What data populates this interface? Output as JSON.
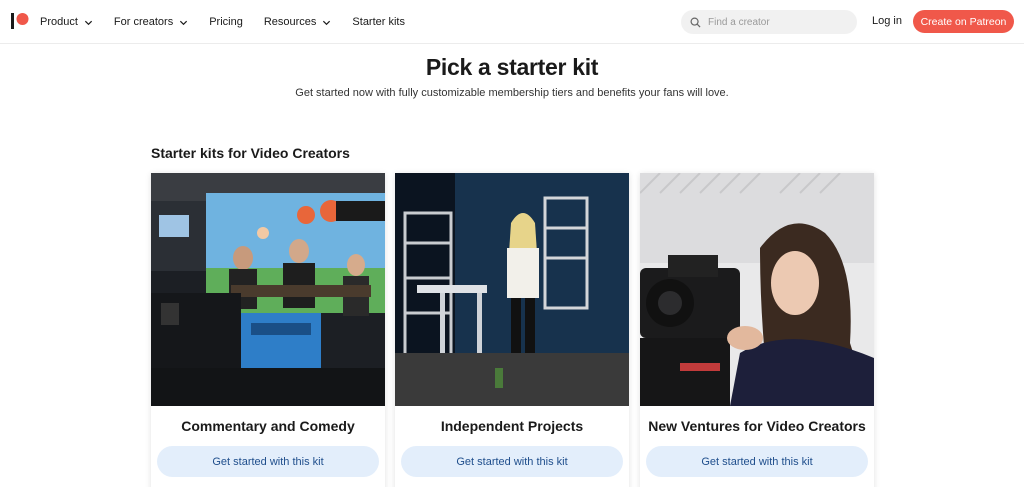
{
  "header": {
    "nav": [
      {
        "label": "Product",
        "has_dropdown": true
      },
      {
        "label": "For creators",
        "has_dropdown": true
      },
      {
        "label": "Pricing",
        "has_dropdown": false
      },
      {
        "label": "Resources",
        "has_dropdown": true
      },
      {
        "label": "Starter kits",
        "has_dropdown": false
      }
    ],
    "search_placeholder": "Find a creator",
    "login_label": "Log in",
    "create_label": "Create on Patreon",
    "accent_color": "#f0584a"
  },
  "hero": {
    "title": "Pick a starter kit",
    "subtitle": "Get started now with fully customizable membership tiers and benefits your fans will love."
  },
  "section": {
    "title": "Starter kits for Video Creators"
  },
  "cards": [
    {
      "title": "Commentary and Comedy",
      "button_label": "Get started with this kit"
    },
    {
      "title": "Independent Projects",
      "button_label": "Get started with this kit"
    },
    {
      "title": "New Ventures for Video Creators",
      "button_label": "Get started with this kit"
    }
  ]
}
